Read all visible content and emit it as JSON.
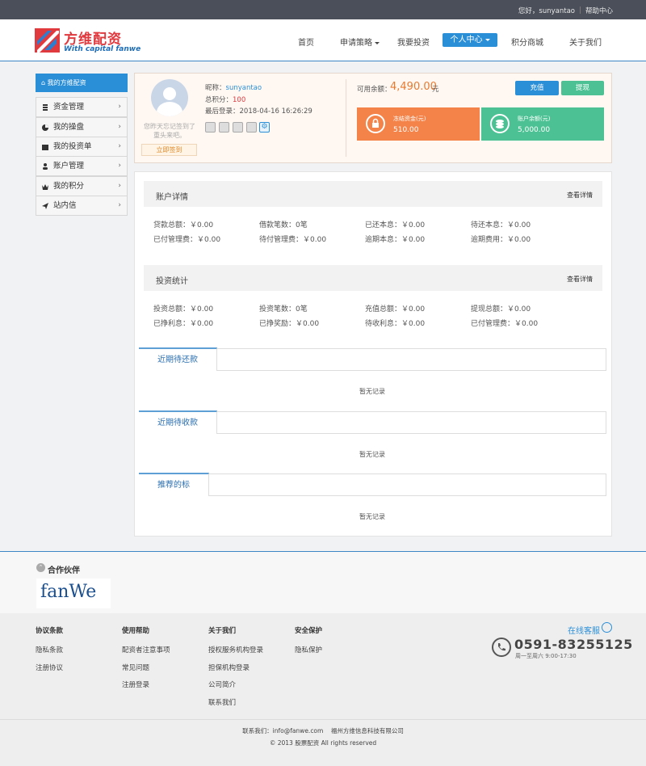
{
  "topbar": {
    "greeting": "您好，sunyantao",
    "help": "帮助中心"
  },
  "brand": {
    "name_cn": "方维配资",
    "name_en": "With capital fanwe"
  },
  "nav": {
    "items": [
      "首页",
      "申请策略",
      "我要投资",
      "个人中心",
      "积分商城",
      "关于我们"
    ],
    "active": "个人中心"
  },
  "sidebar": {
    "title": "我的方维配资",
    "items": [
      "资金管理",
      "我的操盘",
      "我的投资单",
      "账户管理",
      "我的积分",
      "站内信"
    ]
  },
  "user": {
    "nickname_label": "昵称：",
    "nickname": "sunyantao",
    "points_label": "总积分：",
    "points": "100",
    "last_login_label": "最后登录：",
    "last_login": "2018-04-16 16:26:29",
    "sign_note": "您昨天忘记签到了 重头来吧。",
    "sign_button": "立即签到"
  },
  "balance": {
    "available_label": "可用余额：",
    "available": "4,490.00",
    "unit": "元",
    "recharge": "充值",
    "withdraw": "提现",
    "frozen_label": "冻结资金(元)",
    "frozen": "510.00",
    "account_label": "账户余额(元)",
    "account": "5,000.00"
  },
  "colors": {
    "primary": "#2b8fd8",
    "orange": "#f4834a",
    "green": "#4cc294",
    "accent_text": "#e87a2f"
  },
  "account_details": {
    "title": "账户详情",
    "more": "查看详情",
    "rows": [
      [
        "贷款总额：￥0.00",
        "借款笔数：0笔",
        "已还本息：￥0.00",
        "待还本息：￥0.00"
      ],
      [
        "已付管理费：￥0.00",
        "待付管理费：￥0.00",
        "逾期本息：￥0.00",
        "逾期费用：￥0.00"
      ]
    ]
  },
  "invest_stats": {
    "title": "投资统计",
    "more": "查看详情",
    "rows": [
      [
        "投资总额：￥0.00",
        "投资笔数：0笔",
        "充值总额：￥0.00",
        "提现总额：￥0.00"
      ],
      [
        "已挣利息：￥0.00",
        "已挣奖励：￥0.00",
        "待收利息：￥0.00",
        "已付管理费：￥0.00"
      ]
    ]
  },
  "tabs": [
    {
      "label": "近期待还款",
      "empty": "暂无记录"
    },
    {
      "label": "近期待收款",
      "empty": "暂无记录"
    },
    {
      "label": "推荐的标",
      "empty": "暂无记录"
    }
  ],
  "partners": {
    "title": "合作伙伴",
    "logo_text": "fanWe"
  },
  "footer": {
    "columns": [
      {
        "title": "协议条款",
        "links": [
          "隐私条款",
          "注册协议"
        ]
      },
      {
        "title": "使用帮助",
        "links": [
          "配资者注意事项",
          "常见问题",
          "注册登录"
        ]
      },
      {
        "title": "关于我们",
        "links": [
          "授权服务机构登录",
          "担保机构登录",
          "公司简介",
          "联系我们"
        ]
      },
      {
        "title": "安全保护",
        "links": [
          "隐私保护"
        ]
      }
    ],
    "online_service": "在线客服",
    "phone": "0591-83255125",
    "hours": "周一至周六 9:00-17:30",
    "contact": "联系我们：info@fanwe.com    福州方维信息科技有限公司",
    "copyright": "© 2013 股票配资 All rights reserved"
  }
}
